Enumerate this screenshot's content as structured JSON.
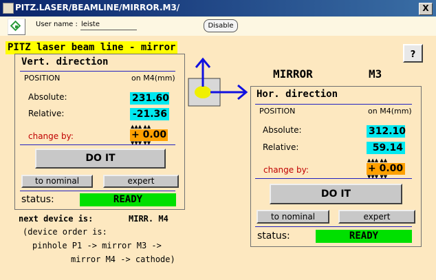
{
  "window": {
    "title": "PITZ.LASER/BEAMLINE/MIRROR.M3/",
    "close_glyph": "X"
  },
  "toolbar": {
    "user_label": "User name :",
    "user_value": "leiste",
    "disable_label": "Disable"
  },
  "page": {
    "title": "PITZ laser beam line - mirror",
    "help_label": "?",
    "mirror_label": "MIRROR",
    "mirror_id": "M3"
  },
  "vertical": {
    "title": "Vert. direction",
    "position_label": "POSITION",
    "position_unit": "on M4(mm)",
    "absolute_label": "Absolute:",
    "absolute_value": "231.60",
    "relative_label": "Relative:",
    "relative_value": "-21.36",
    "change_label": "change by:",
    "change_value": "+ 0.00",
    "do_it_label": "DO IT",
    "nominal_label": "to nominal",
    "expert_label": "expert",
    "status_label": "status:",
    "status_value": "READY"
  },
  "horizontal": {
    "title": "Hor. direction",
    "position_label": "POSITION",
    "position_unit": "on M4(mm)",
    "absolute_label": "Absolute:",
    "absolute_value": "312.10",
    "relative_label": "Relative:",
    "relative_value": "59.14",
    "change_label": "change by:",
    "change_value": "+ 0.00",
    "do_it_label": "DO IT",
    "nominal_label": "to nominal",
    "expert_label": "expert",
    "status_label": "status:",
    "status_value": "READY"
  },
  "next_device": {
    "label": "next device is:",
    "value": "MIRR. M4",
    "order_line1": "(device order is:",
    "order_line2": "pinhole P1 -> mirror M3 ->",
    "order_line3": "mirror M4 -> cathode)"
  },
  "colors": {
    "title_highlight": "#ffff00",
    "value_cyan": "#00e8f0",
    "change_orange": "#ffa000",
    "status_green": "#00e000",
    "arrow_blue": "#1010e0",
    "beam_spot": "#f0f000",
    "panel_bg": "#fde8c0"
  },
  "icons": {
    "home": "green-diamond-icon",
    "direction": "xy-arrows-icon"
  }
}
